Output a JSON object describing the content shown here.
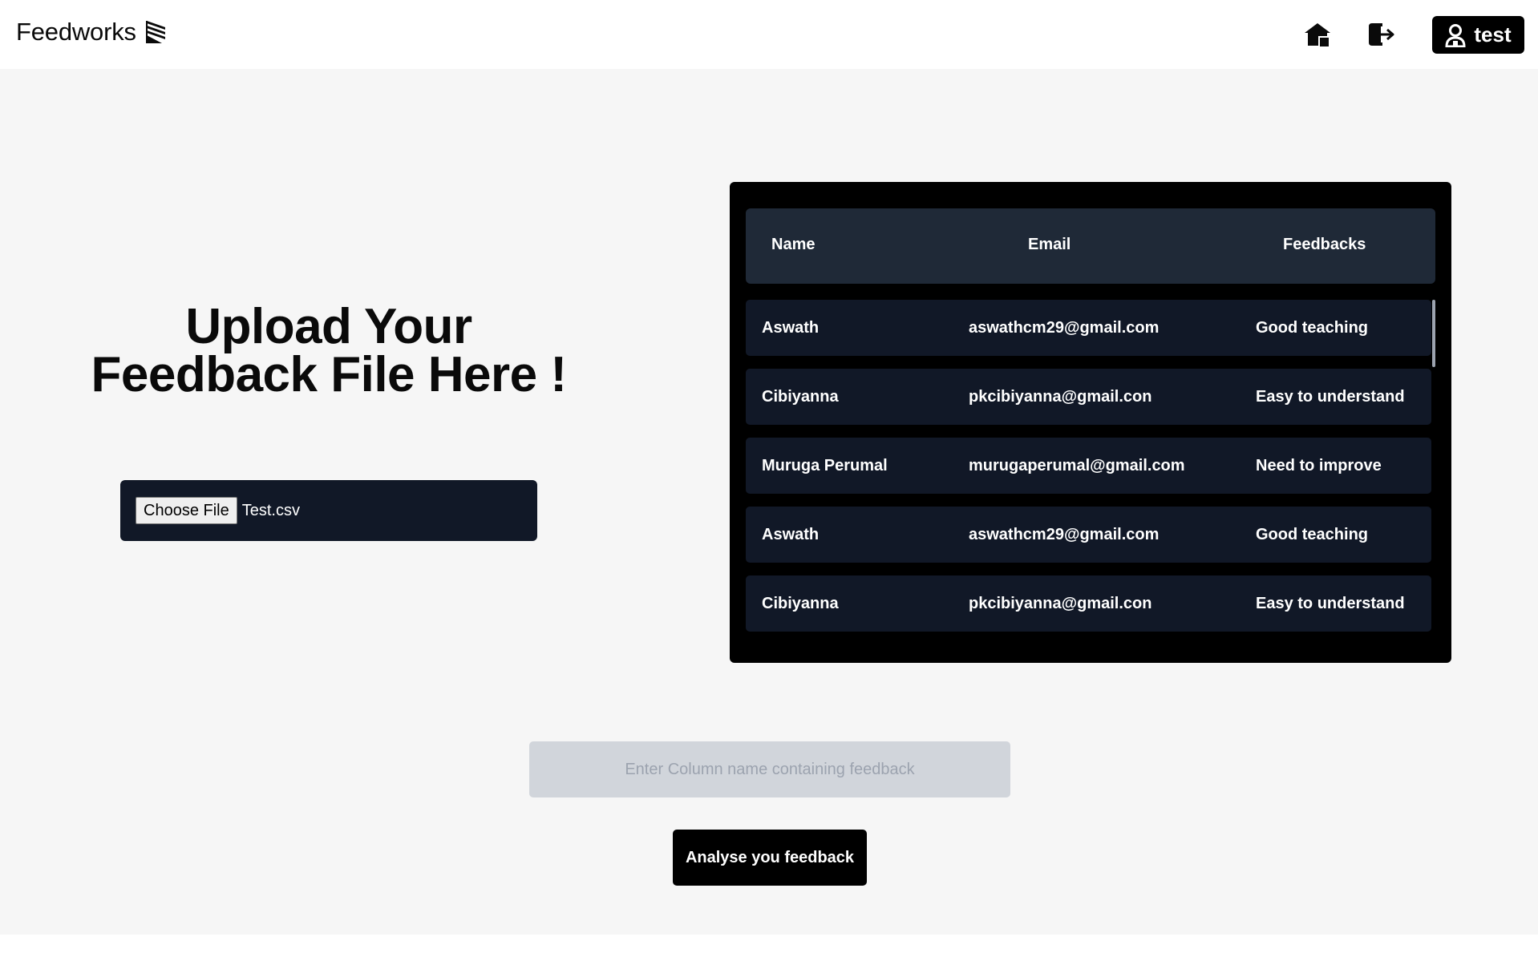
{
  "header": {
    "brand": "Feedworks",
    "user_label": "test"
  },
  "upload": {
    "title_line1": "Upload Your",
    "title_line2": "Feedback File Here !",
    "choose_file_label": "Choose File",
    "file_name": "Test.csv"
  },
  "table": {
    "headers": [
      "Name",
      "Email",
      "Feedbacks"
    ],
    "rows": [
      {
        "name": "Aswath",
        "email": "aswathcm29@gmail.com",
        "feedback": "Good teaching"
      },
      {
        "name": "Cibiyanna",
        "email": "pkcibiyanna@gmail.con",
        "feedback": "Easy to understand"
      },
      {
        "name": "Muruga Perumal",
        "email": "murugaperumal@gmail.com",
        "feedback": "Need to improve"
      },
      {
        "name": "Aswath",
        "email": "aswathcm29@gmail.com",
        "feedback": "Good teaching"
      },
      {
        "name": "Cibiyanna",
        "email": "pkcibiyanna@gmail.con",
        "feedback": "Easy to understand"
      }
    ]
  },
  "analysis": {
    "column_placeholder": "Enter Column name containing feedback",
    "analyse_label": "Analyse you feedback"
  },
  "icons": {
    "brand": "book-pages-icon",
    "home": "home-icon",
    "logout": "logout-icon",
    "user": "user-icon"
  },
  "colors": {
    "panel_bg": "#000000",
    "header_row_bg": "#1f2937",
    "row_bg": "#111827",
    "page_bg": "#f6f6f6"
  }
}
